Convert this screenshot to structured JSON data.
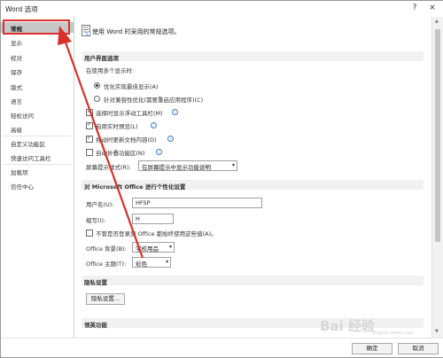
{
  "window": {
    "title": "Word 选项",
    "help": "?",
    "close": "×"
  },
  "sidebar": {
    "items": [
      {
        "label": "常规"
      },
      {
        "label": "显示"
      },
      {
        "label": "校对"
      },
      {
        "label": "保存"
      },
      {
        "label": "版式"
      },
      {
        "label": "语言"
      },
      {
        "label": "轻松访问"
      },
      {
        "label": "高级"
      },
      {
        "label": "自定义功能区"
      },
      {
        "label": "快速访问工具栏"
      },
      {
        "label": "加载项"
      },
      {
        "label": "信任中心"
      }
    ],
    "selected": "常规"
  },
  "main": {
    "header": "使用 Word 时采用的常规选项。",
    "ui_section": {
      "title": "用户界面选项",
      "multi_display_label": "在使用多个显示时:",
      "radio_optimize": "优化实现最佳显示(A)",
      "radio_compat": "针对兼容性优化(需要重启应用程序)(C)",
      "cb_minitoolbar": "选择时显示浮动工具栏(M)",
      "cb_livepreview": "启用实时预览(L)",
      "cb_update_drag": "拖动时更新文档内容(D)",
      "cb_collapse_ribbon": "自动折叠功能区(N)",
      "screentip_label": "屏幕提示样式(R):",
      "screentip_value": "在屏幕提示中显示功能说明"
    },
    "personalize_section": {
      "title": "对 Microsoft Office 进行个性化设置",
      "username_label": "用户名(U):",
      "username_value": "HFSP",
      "initials_label": "缩写(I):",
      "initials_value": "H",
      "cb_always_use": "不管是否登录到 Office 都始终使用这些值(A)。",
      "background_label": "Office 背景(B):",
      "background_value": "学校用品",
      "theme_label": "Office 主题(T):",
      "theme_value": "彩色"
    },
    "privacy_section": {
      "title": "隐私设置",
      "button": "隐私设置..."
    },
    "video_section": {
      "title": "领英功能"
    }
  },
  "footer": {
    "ok": "确定",
    "cancel": "取消"
  },
  "watermark": {
    "main": "Bai 经验",
    "sub": "jingyan.baidu.com"
  },
  "colors": {
    "highlight": "#d9302a",
    "selected_bg": "#c7c7c7",
    "section_bg": "#f1f1f1"
  }
}
